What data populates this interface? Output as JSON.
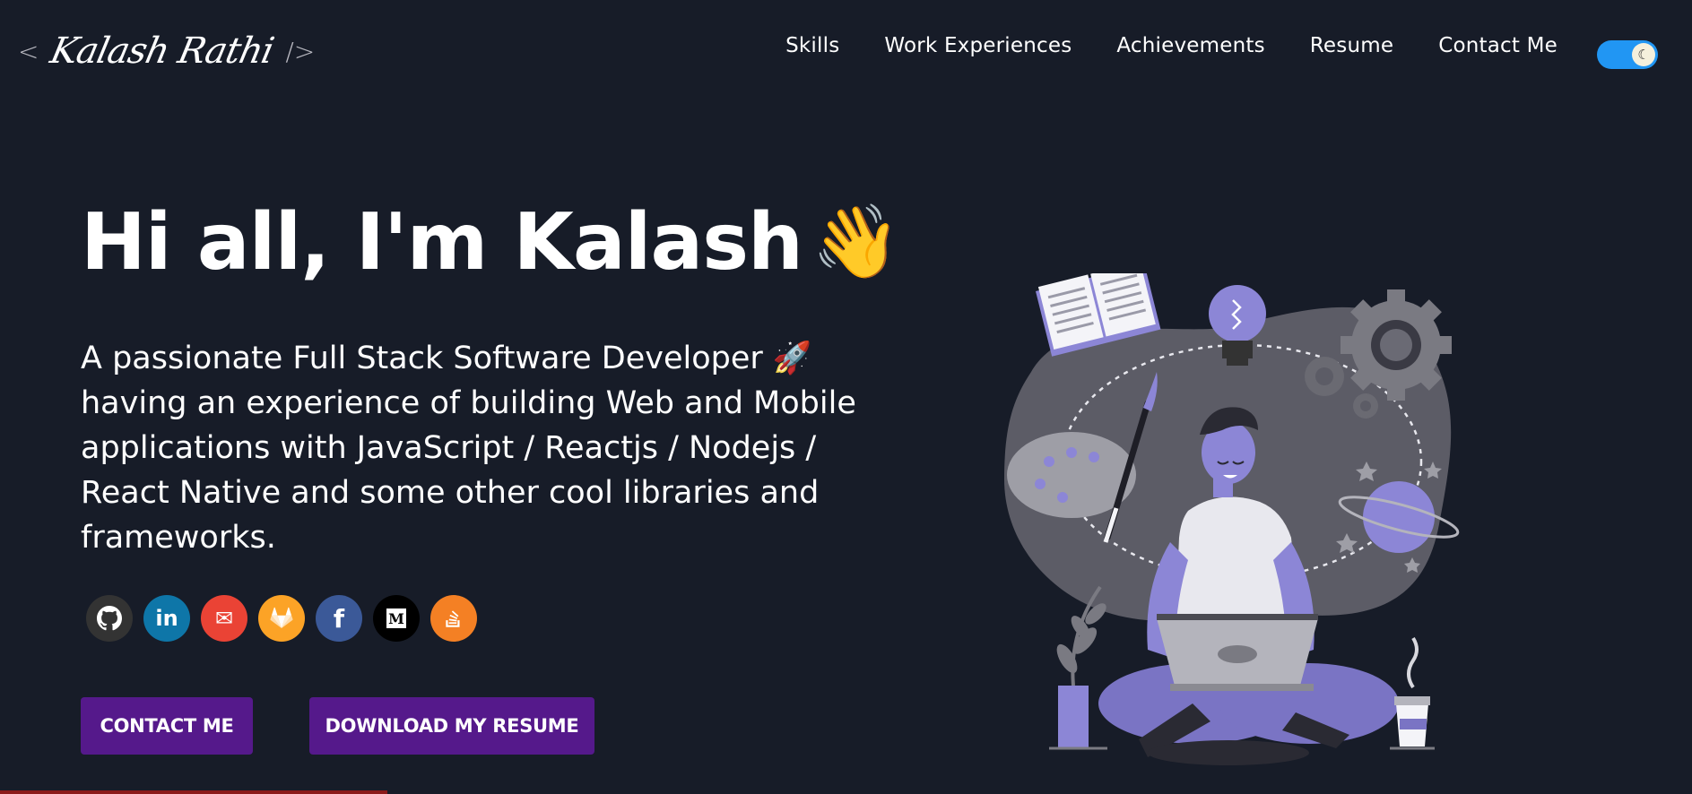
{
  "header": {
    "logo": {
      "open_bracket": "<",
      "name": "Kalash Rathi",
      "close_bracket": "/>"
    },
    "nav": [
      {
        "label": "Skills"
      },
      {
        "label": "Work Experiences"
      },
      {
        "label": "Achievements"
      },
      {
        "label": "Resume"
      },
      {
        "label": "Contact Me"
      }
    ],
    "theme_toggle": {
      "state": "dark",
      "knob_icon": "moon-icon"
    }
  },
  "hero": {
    "greeting": "Hi all, I'm Kalash",
    "wave_emoji": "👋",
    "subtitle": "A passionate Full Stack Software Developer 🚀 having an experience of building Web and Mobile applications with JavaScript / Reactjs / Nodejs / React Native and some other cool libraries and frameworks.",
    "social": [
      {
        "icon": "github-icon",
        "glyph": "",
        "color": "#333333"
      },
      {
        "icon": "linkedin-icon",
        "glyph": "in",
        "color": "#0e76a8"
      },
      {
        "icon": "mail-icon",
        "glyph": "✉",
        "color": "#ea4335"
      },
      {
        "icon": "gitlab-icon",
        "glyph": "",
        "color": "#fca326"
      },
      {
        "icon": "facebook-icon",
        "glyph": "f",
        "color": "#3b5998"
      },
      {
        "icon": "medium-icon",
        "glyph": "M",
        "color": "#000000"
      },
      {
        "icon": "stackoverflow-icon",
        "glyph": "",
        "color": "#f48024"
      }
    ],
    "buttons": {
      "contact": "CONTACT ME",
      "resume": "DOWNLOAD MY RESUME"
    }
  },
  "colors": {
    "background": "#171c28",
    "button": "#55198b",
    "toggle": "#2196f3",
    "illustration_accent": "#8c86d6"
  }
}
